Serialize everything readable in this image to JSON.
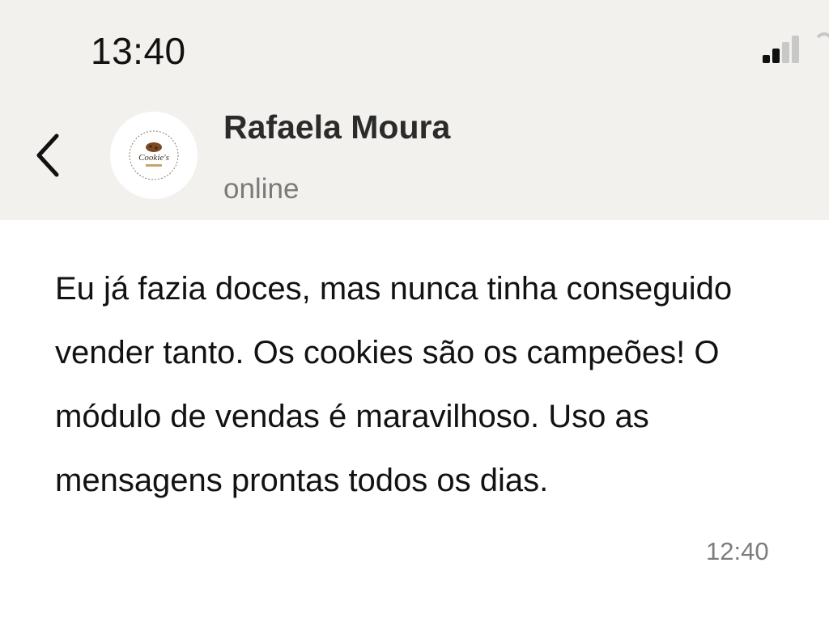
{
  "status_bar": {
    "time": "13:40",
    "signal_icon": "signal-bars-icon",
    "wifi_icon": "wifi-icon"
  },
  "chat_header": {
    "back_icon": "chevron-left-icon",
    "contact_name": "Rafaela Moura",
    "contact_status": "online",
    "avatar_logo_text": "Cookie's"
  },
  "messages": [
    {
      "text": "Eu já fazia doces, mas nunca tinha conseguido vender tanto. Os cookies são os campeões! O módulo de vendas é maravilhoso. Uso as mensagens prontas todos os dias.",
      "time": "12:40"
    }
  ],
  "colors": {
    "header_bg": "#f2f1ee",
    "message_text": "#121212",
    "secondary_text": "#7a7a7a"
  }
}
